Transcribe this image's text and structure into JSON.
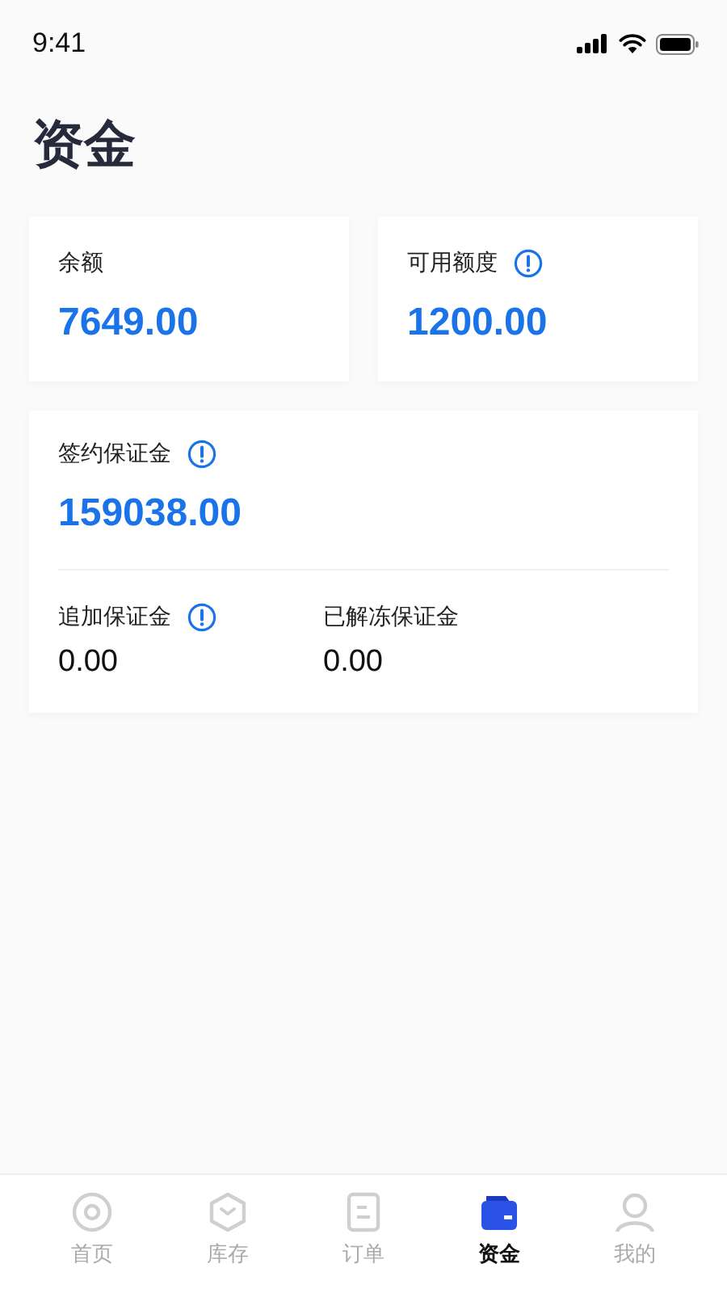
{
  "status_bar": {
    "time": "9:41"
  },
  "title": "资金",
  "summary_cards": [
    {
      "label": "余额",
      "info": false,
      "value": "7649.00"
    },
    {
      "label": "可用额度",
      "info": true,
      "value": "1200.00"
    }
  ],
  "deposit_card": {
    "label": "签约保证金",
    "info": true,
    "value": "159038.00",
    "items": [
      {
        "label": "追加保证金",
        "info": true,
        "value": "0.00"
      },
      {
        "label": "已解冻保证金",
        "info": false,
        "value": "0.00"
      }
    ]
  },
  "tab_bar": [
    {
      "label": "首页",
      "selected": false
    },
    {
      "label": "库存",
      "selected": false
    },
    {
      "label": "订单",
      "selected": false
    },
    {
      "label": "资金",
      "selected": true
    },
    {
      "label": "我的",
      "selected": false
    }
  ]
}
